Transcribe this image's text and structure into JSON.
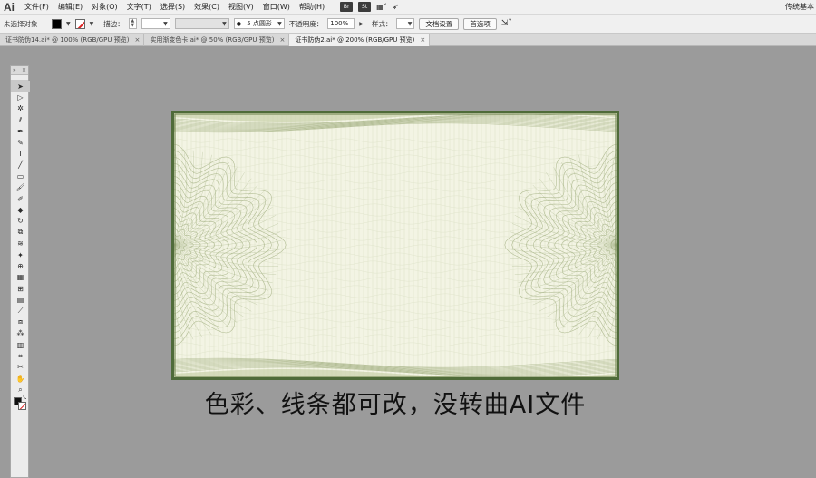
{
  "app": {
    "logo": "Ai",
    "workspace": "传统基本"
  },
  "menu": {
    "items": [
      "文件(F)",
      "编辑(E)",
      "对象(O)",
      "文字(T)",
      "选择(S)",
      "效果(C)",
      "视图(V)",
      "窗口(W)",
      "帮助(H)"
    ],
    "ext_badges": [
      "Br",
      "St"
    ]
  },
  "control": {
    "selection_status": "未选择对象",
    "stroke_label": "描边：",
    "brush_value": "5 点圆形",
    "opacity_label": "不透明度：",
    "opacity_value": "100%",
    "style_label": "样式：",
    "doc_setup_button": "文档设置",
    "preferences_button": "首选项"
  },
  "tabs": [
    {
      "label": "证书防伪14.ai* @ 100% (RGB/GPU 预览)",
      "active": false
    },
    {
      "label": "实用渐变色卡.ai* @ 50% (RGB/GPU 预览)",
      "active": false
    },
    {
      "label": "证书防伪2.ai* @ 200% (RGB/GPU 预览)",
      "active": true
    }
  ],
  "tools": [
    "selection-tool",
    "direct-selection-tool",
    "magic-wand-tool",
    "lasso-tool",
    "pen-tool",
    "curvature-tool",
    "type-tool",
    "line-segment-tool",
    "rectangle-tool",
    "paintbrush-tool",
    "shaper-tool",
    "eraser-tool",
    "rotate-tool",
    "scale-tool",
    "warp-tool",
    "puppet-warp-tool",
    "shape-builder-tool",
    "perspective-grid-tool",
    "mesh-tool",
    "gradient-tool",
    "eyedropper-tool",
    "blend-tool",
    "symbol-sprayer-tool",
    "column-graph-tool",
    "artboard-tool",
    "slice-tool",
    "hand-tool",
    "zoom-tool"
  ],
  "colors": {
    "artboard_bg": "#f3f4e4",
    "border": "#4f6b39",
    "pattern": "#a6b386",
    "canvas": "#9b9b9b"
  },
  "caption": "色彩、线条都可改，没转曲AI文件"
}
